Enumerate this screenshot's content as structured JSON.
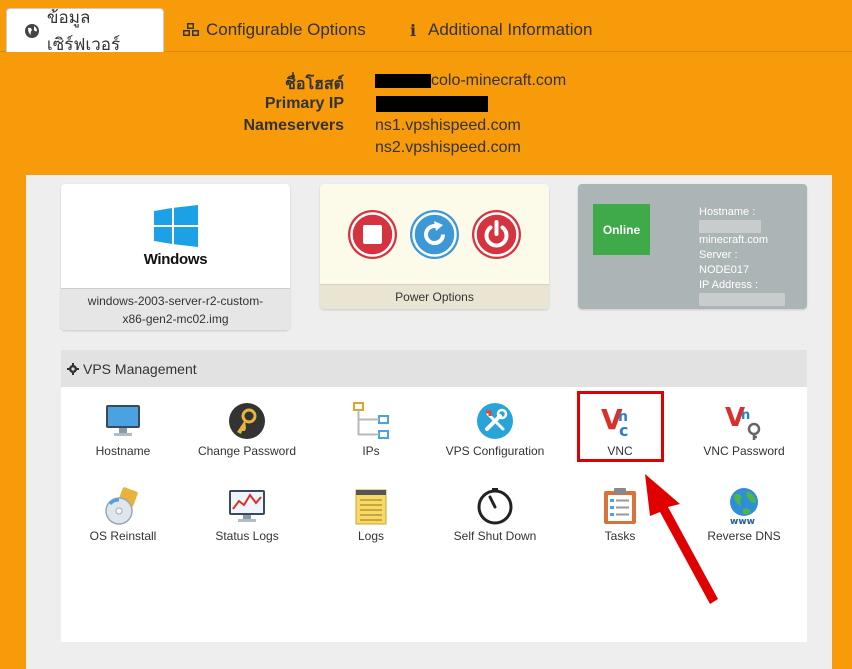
{
  "tabs": [
    {
      "label": "ข้อมูลเซิร์ฟเวอร์",
      "icon": "globe-icon",
      "active": true
    },
    {
      "label": "Configurable Options",
      "icon": "cubes-icon",
      "active": false
    },
    {
      "label": "Additional Information",
      "icon": "info-icon",
      "active": false
    }
  ],
  "info": {
    "hostname_label": "ชื่อโฮสต์",
    "hostname_value": "colo-minecraft.com",
    "ip_label": "Primary IP",
    "ns_label": "Nameservers",
    "ns1": "ns1.vpshispeed.com",
    "ns2": "ns2.vpshispeed.com"
  },
  "os": {
    "logo_label": "Windows",
    "image_name_line1": "windows-2003-server-r2-custom-",
    "image_name_line2": "x86-gen2-mc02.img"
  },
  "power": {
    "footer": "Power Options",
    "buttons": [
      "stop-icon",
      "restart-icon",
      "power-icon"
    ]
  },
  "status": {
    "state": "Online",
    "hostname_label": "Hostname :",
    "hostname_value": "minecraft.com",
    "server_label": "Server :",
    "server_value": "NODE017",
    "ip_label": "IP Address :"
  },
  "management": {
    "title": "VPS Management",
    "items": [
      {
        "label": "Hostname",
        "icon": "monitor-icon"
      },
      {
        "label": "Change Password",
        "icon": "key-icon"
      },
      {
        "label": "IPs",
        "icon": "network-icon"
      },
      {
        "label": "VPS Configuration",
        "icon": "tools-icon"
      },
      {
        "label": "VNC",
        "icon": "vnc-icon"
      },
      {
        "label": "VNC Password",
        "icon": "vnc-key-icon"
      },
      {
        "label": "OS Reinstall",
        "icon": "disc-icon"
      },
      {
        "label": "Status Logs",
        "icon": "chart-icon"
      },
      {
        "label": "Logs",
        "icon": "notepad-icon"
      },
      {
        "label": "Self Shut Down",
        "icon": "timer-icon"
      },
      {
        "label": "Tasks",
        "icon": "clipboard-icon"
      },
      {
        "label": "Reverse DNS",
        "icon": "globe-www-icon"
      }
    ]
  },
  "colors": {
    "brand_orange": "#f79b0b",
    "online_green": "#3eaa49",
    "power_red": "#d5333d",
    "power_blue": "#3d98d8",
    "highlight_red": "#e00000"
  }
}
